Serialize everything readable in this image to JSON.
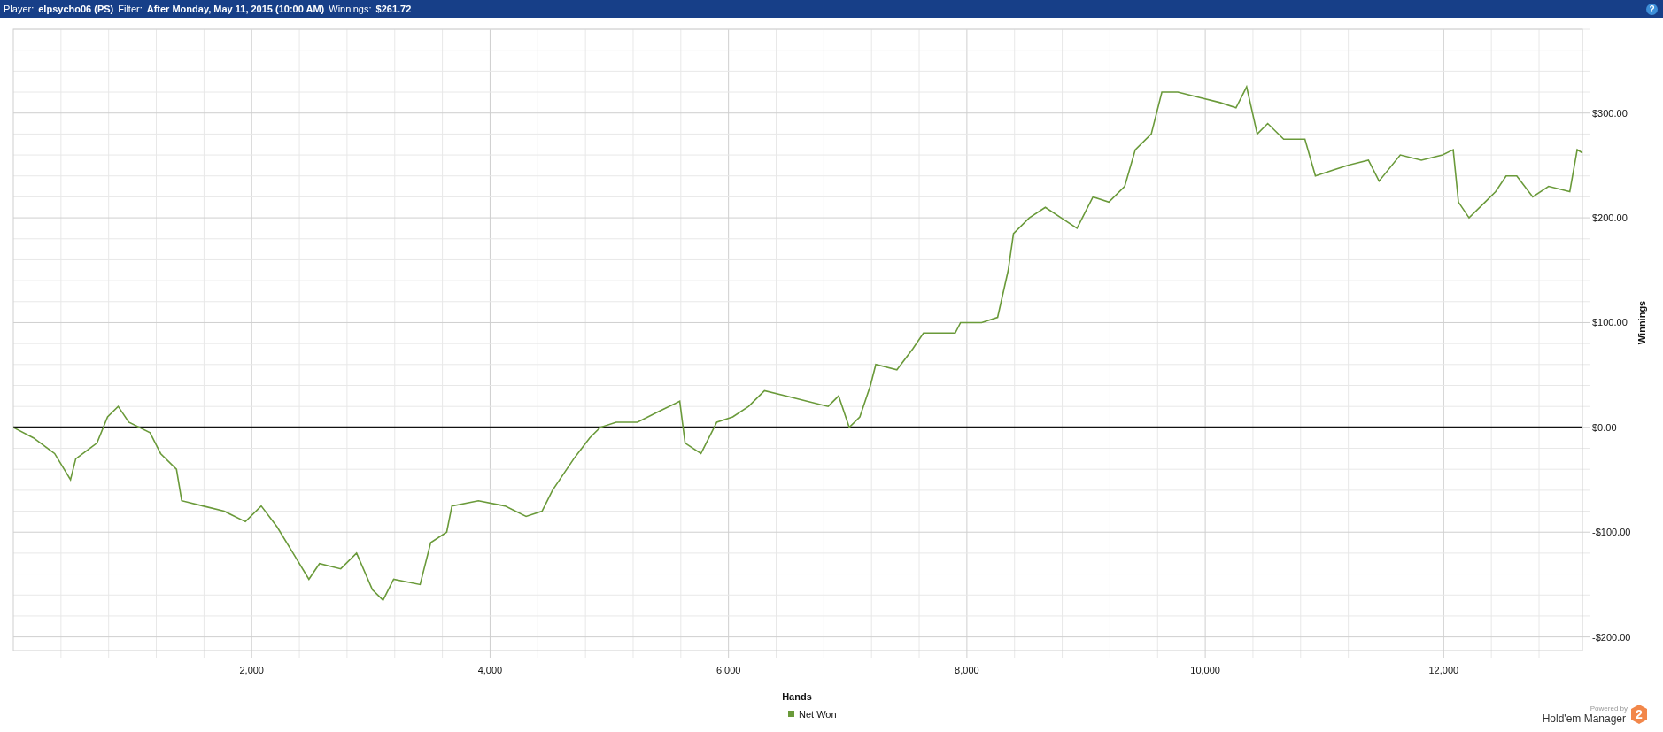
{
  "header": {
    "fields": [
      {
        "label": "Player:",
        "value": "elpsycho06 (PS)"
      },
      {
        "label": "Filter:",
        "value": "After Monday, May 11, 2015 (10:00 AM)"
      },
      {
        "label": "Winnings:",
        "value": "$261.72"
      }
    ],
    "help_button": "?"
  },
  "chart_data": {
    "type": "line",
    "grid": true,
    "xlabel": "Hands",
    "ylabel": "Winnings",
    "xlim": [
      0,
      13164
    ],
    "ylim": [
      -213,
      380
    ],
    "xticks": [
      {
        "value": 2000,
        "label": "2,000"
      },
      {
        "value": 4000,
        "label": "4,000"
      },
      {
        "value": 6000,
        "label": "6,000"
      },
      {
        "value": 8000,
        "label": "8,000"
      },
      {
        "value": 10000,
        "label": "10,000"
      },
      {
        "value": 12000,
        "label": "12,000"
      }
    ],
    "yticks": [
      {
        "value": -200,
        "label": "-$200.00"
      },
      {
        "value": -100,
        "label": "-$100.00"
      },
      {
        "value": 0,
        "label": "$0.00"
      },
      {
        "value": 100,
        "label": "$100.00"
      },
      {
        "value": 200,
        "label": "$200.00"
      },
      {
        "value": 300,
        "label": "$300.00"
      }
    ],
    "x": [
      0,
      169,
      347,
      480,
      524,
      702,
      791,
      880,
      969,
      1147,
      1236,
      1369,
      1413,
      1591,
      1769,
      1947,
      2080,
      2213,
      2347,
      2480,
      2569,
      2747,
      2880,
      3013,
      3102,
      3191,
      3413,
      3502,
      3636,
      3680,
      3902,
      4124,
      4302,
      4436,
      4524,
      4702,
      4836,
      4924,
      5058,
      5236,
      5413,
      5591,
      5636,
      5769,
      5902,
      6036,
      6169,
      6302,
      6480,
      6658,
      6836,
      6924,
      7013,
      7102,
      7191,
      7236,
      7413,
      7547,
      7636,
      7769,
      7902,
      7947,
      8124,
      8258,
      8347,
      8391,
      8524,
      8658,
      8791,
      8924,
      9058,
      9191,
      9324,
      9413,
      9547,
      9636,
      9769,
      9947,
      10124,
      10258,
      10347,
      10436,
      10524,
      10658,
      10836,
      10924,
      11058,
      11191,
      11369,
      11458,
      11636,
      11813,
      11991,
      12080,
      12124,
      12213,
      12347,
      12436,
      12524,
      12613,
      12747,
      12880,
      13058,
      13120,
      13164
    ],
    "series": [
      {
        "name": "Net Won",
        "color": "#6a9a3a",
        "values": [
          0,
          -10,
          -25,
          -50,
          -30,
          -15,
          10,
          20,
          5,
          -5,
          -25,
          -40,
          -70,
          -75,
          -80,
          -90,
          -75,
          -95,
          -120,
          -145,
          -130,
          -135,
          -120,
          -155,
          -165,
          -145,
          -150,
          -110,
          -100,
          -75,
          -70,
          -75,
          -85,
          -80,
          -60,
          -30,
          -10,
          0,
          5,
          5,
          15,
          25,
          -15,
          -25,
          5,
          10,
          20,
          35,
          30,
          25,
          20,
          30,
          0,
          10,
          40,
          60,
          55,
          75,
          90,
          90,
          90,
          100,
          100,
          105,
          150,
          185,
          200,
          210,
          200,
          190,
          220,
          215,
          230,
          265,
          280,
          320,
          320,
          315,
          310,
          305,
          325,
          280,
          290,
          275,
          275,
          240,
          245,
          250,
          255,
          235,
          260,
          255,
          260,
          265,
          215,
          200,
          215,
          225,
          240,
          240,
          220,
          230,
          225,
          265,
          262
        ]
      }
    ]
  },
  "branding": {
    "caption": "Powered by",
    "product": "Hold'em Manager",
    "badge": "2"
  }
}
